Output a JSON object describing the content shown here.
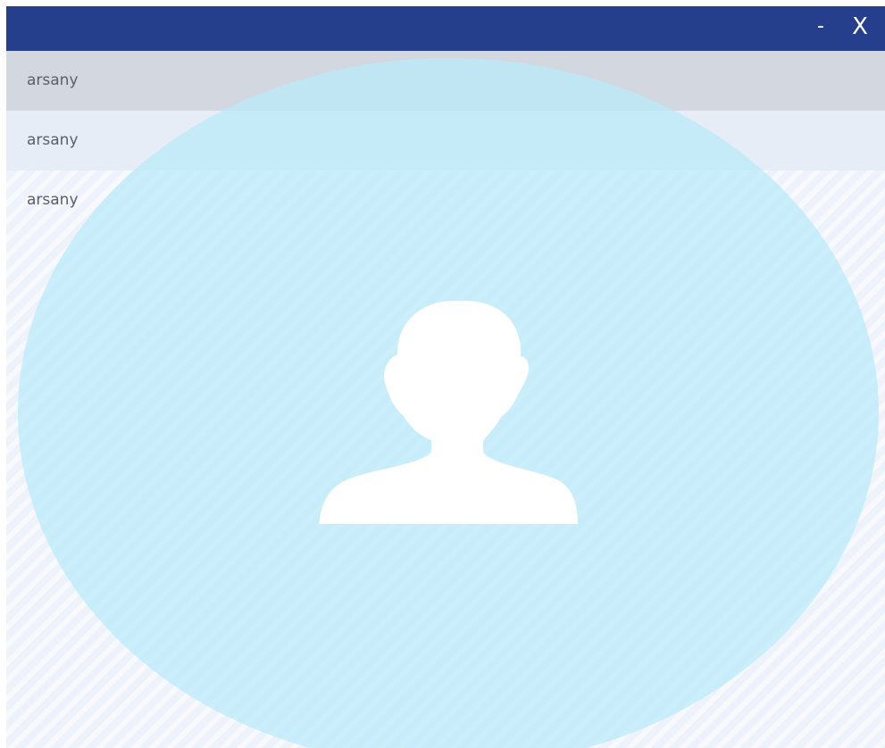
{
  "window": {
    "minimize_label": "-",
    "close_label": "X"
  },
  "contacts": [
    {
      "name": "arsany"
    },
    {
      "name": "arsany"
    },
    {
      "name": "arsany"
    }
  ],
  "avatar": {
    "icon": "user-silhouette-icon"
  },
  "colors": {
    "titlebar": "#263f8c",
    "selected_row": "#d3d8e0",
    "row": "#e7edf7",
    "avatar_disc": "#b8eafa"
  }
}
